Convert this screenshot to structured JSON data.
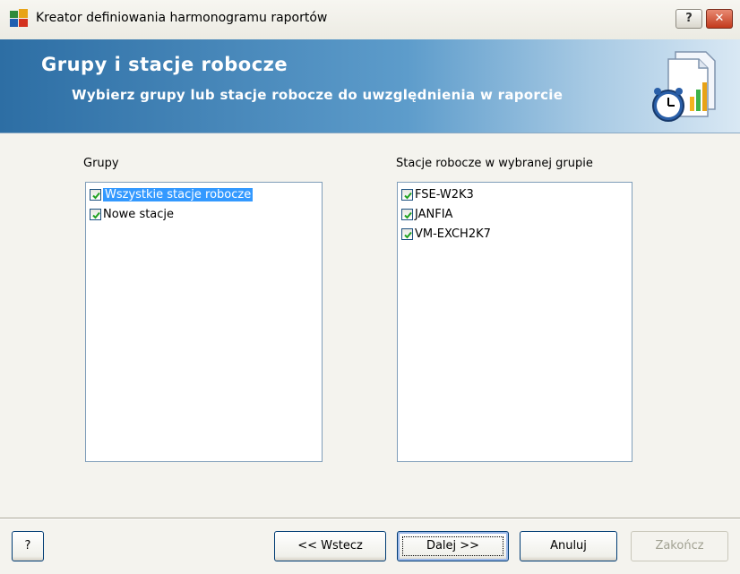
{
  "window": {
    "title": "Kreator definiowania harmonogramu raportów",
    "help_button": "?",
    "close_button": "✕"
  },
  "banner": {
    "title": "Grupy i stacje robocze",
    "subtitle": "Wybierz grupy lub stacje robocze do uwzględnienia w raporcie",
    "icon": "report-clock-icon"
  },
  "groups": {
    "label": "Grupy",
    "items": [
      {
        "label": "Wszystkie stacje robocze",
        "checked": true,
        "selected": true
      },
      {
        "label": "Nowe stacje",
        "checked": true,
        "selected": false
      }
    ]
  },
  "stations": {
    "label": "Stacje robocze w wybranej grupie",
    "items": [
      {
        "label": "FSE-W2K3",
        "checked": true
      },
      {
        "label": "JANFIA",
        "checked": true
      },
      {
        "label": "VM-EXCH2K7",
        "checked": true
      }
    ]
  },
  "footer": {
    "help_label": "?",
    "back_label": "<< Wstecz",
    "next_label": "Dalej >>",
    "cancel_label": "Anuluj",
    "finish_label": "Zakończ"
  },
  "colors": {
    "banner_start": "#2d6ea4",
    "selection": "#3399ff",
    "close_button": "#c2391c"
  }
}
